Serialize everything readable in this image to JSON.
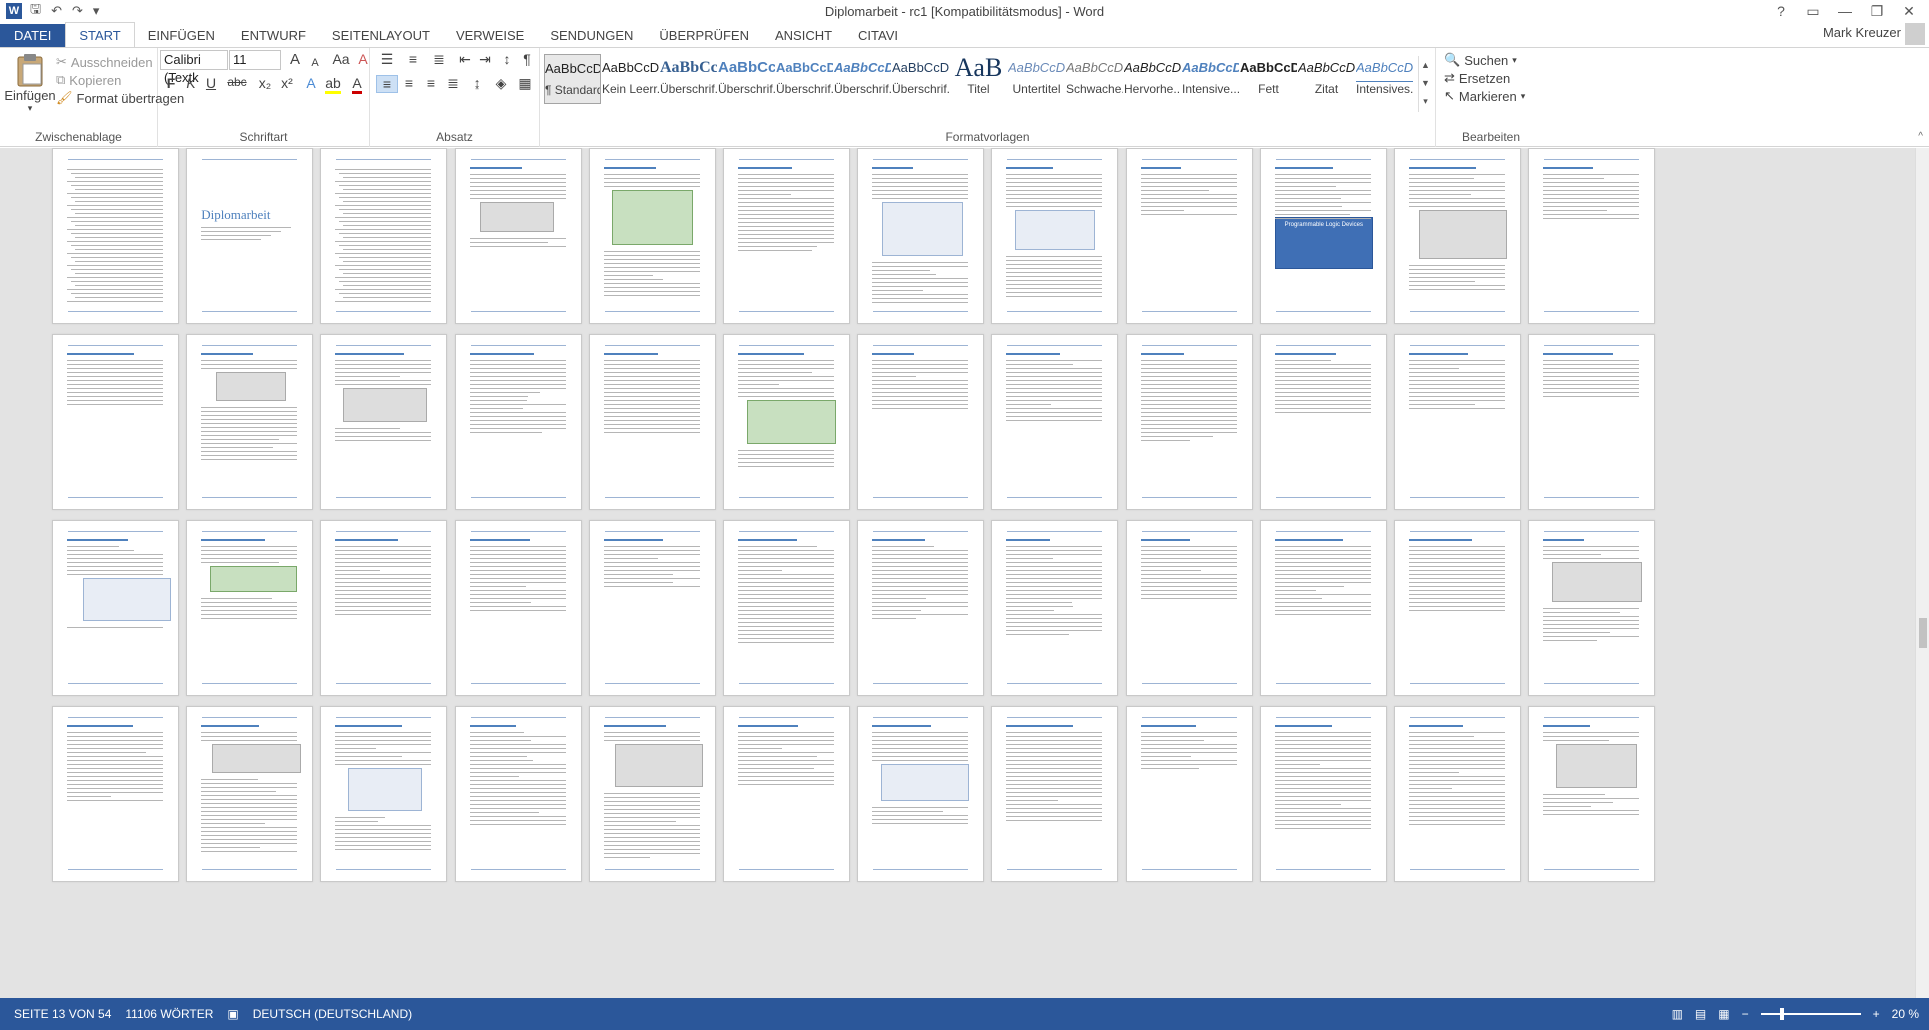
{
  "window": {
    "title": "Diplomarbeit - rc1 [Kompatibilitätsmodus] - Word",
    "app_icon": "W",
    "controls": [
      "?",
      "▭",
      "—",
      "❐",
      "✕"
    ]
  },
  "qat": {
    "save_icon": "save-icon",
    "undo_icon": "undo-icon",
    "redo_icon": "redo-icon"
  },
  "tabs": {
    "file": "DATEI",
    "items": [
      "START",
      "EINFÜGEN",
      "ENTWURF",
      "SEITENLAYOUT",
      "VERWEISE",
      "SENDUNGEN",
      "ÜBERPRÜFEN",
      "ANSICHT",
      "CITAVI"
    ],
    "active": "START",
    "user": "Mark Kreuzer"
  },
  "clipboard": {
    "paste": "Einfügen",
    "cut": "Ausschneiden",
    "copy": "Kopieren",
    "format_painter": "Format übertragen",
    "label": "Zwischenablage"
  },
  "font": {
    "family": "Calibri (Textk",
    "size": "11",
    "label": "Schriftart",
    "bold": "F",
    "italic": "K",
    "underline": "U",
    "strike": "abc",
    "subscript": "x₂",
    "superscript": "x²",
    "grow": "A",
    "shrink": "A",
    "case": "Aa",
    "clear": "A"
  },
  "paragraph": {
    "label": "Absatz",
    "pilcrow": "¶"
  },
  "styles": {
    "label": "Formatvorlagen",
    "items": [
      {
        "sample": "AaBbCcDd",
        "name": "¶ Standard"
      },
      {
        "sample": "AaBbCcDd",
        "name": "Kein Leerr..."
      },
      {
        "sample": "AaBbCc",
        "name": "Überschrif..."
      },
      {
        "sample": "AaBbCc",
        "name": "Überschrif..."
      },
      {
        "sample": "AaBbCcD",
        "name": "Überschrif..."
      },
      {
        "sample": "AaBbCcD",
        "name": "Überschrif..."
      },
      {
        "sample": "AaBbCcDc",
        "name": "Überschrif..."
      },
      {
        "sample": "AaB",
        "name": "Titel"
      },
      {
        "sample": "AaBbCcDd",
        "name": "Untertitel"
      },
      {
        "sample": "AaBbCcDd",
        "name": "Schwache..."
      },
      {
        "sample": "AaBbCcDd",
        "name": "Hervorhe..."
      },
      {
        "sample": "AaBbCcDd",
        "name": "Intensive..."
      },
      {
        "sample": "AaBbCcDc",
        "name": "Fett"
      },
      {
        "sample": "AaBbCcDd",
        "name": "Zitat"
      },
      {
        "sample": "AaBbCcDd",
        "name": "Intensives..."
      }
    ]
  },
  "editing": {
    "label": "Bearbeiten",
    "find": "Suchen",
    "replace": "Ersetzen",
    "select": "Markieren"
  },
  "pages": {
    "cover_title": "Diplomarbeit",
    "fpga_box_title": "Programmable Logic Devices"
  },
  "status": {
    "page": "SEITE 13 VON 54",
    "words": "11106 WÖRTER",
    "language": "DEUTSCH (DEUTSCHLAND)",
    "zoom": "20 %",
    "zoom_level": 0.2
  },
  "colors": {
    "accent": "#2b579a",
    "heading": "#4f81bd"
  }
}
